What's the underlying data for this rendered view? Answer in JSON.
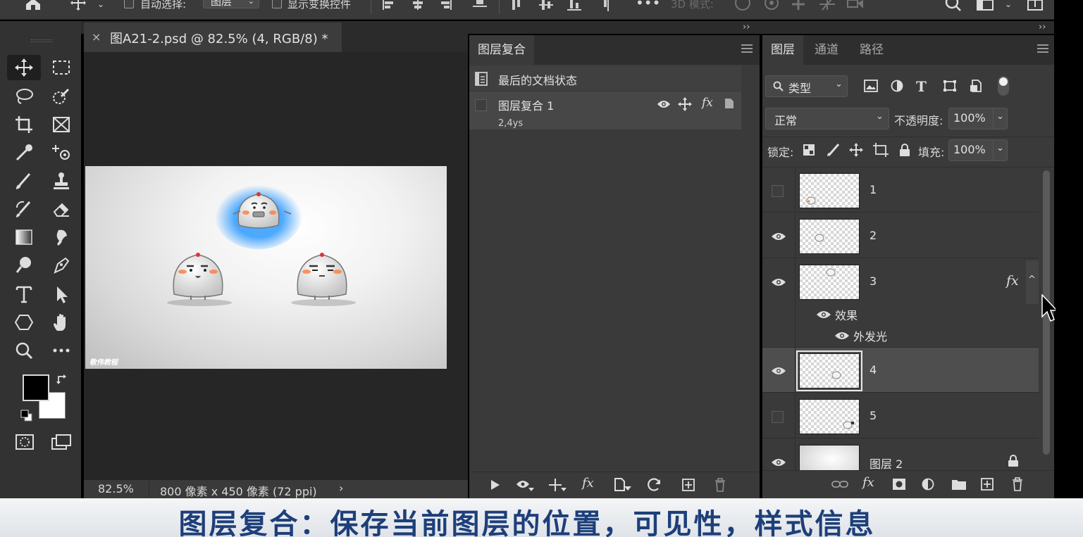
{
  "options_bar": {
    "auto_select_label": "自动选择:",
    "auto_select_target": "图层",
    "show_transform_label": "显示变换控件",
    "mode_3d_label": "3D 模式:"
  },
  "document": {
    "tab_title": "图A21-2.psd @ 82.5% (4, RGB/8) *",
    "zoom": "82.5%",
    "doc_info": "800 像素 x 450 像素 (72 ppi)",
    "watermark": "敬伟教程"
  },
  "layer_comps_panel": {
    "tab": "图层复合",
    "last_state": "最后的文档状态",
    "comps": [
      {
        "name": "图层复合 1",
        "note": "2,4ys"
      }
    ]
  },
  "layers_panel": {
    "tabs": [
      "图层",
      "通道",
      "路径"
    ],
    "filter_kind": "类型",
    "blend_mode": "正常",
    "opacity_label": "不透明度:",
    "opacity_value": "100%",
    "lock_label": "锁定:",
    "fill_label": "填充:",
    "fill_value": "100%",
    "layers": [
      {
        "name": "1",
        "visible": false
      },
      {
        "name": "2",
        "visible": true
      },
      {
        "name": "3",
        "visible": true,
        "fx": "fx",
        "effects_label": "效果",
        "effect": "外发光"
      },
      {
        "name": "4",
        "visible": true,
        "selected": true
      },
      {
        "name": "5",
        "visible": false
      },
      {
        "name": "图层 2",
        "visible": true,
        "locked": true
      }
    ]
  },
  "subtitle": "图层复合：保存当前图层的位置，可见性，样式信息",
  "colors": {
    "accent_glow": "#3aa0ff",
    "subtitle_text": "#1d3f7a",
    "foreground": "#000000",
    "background": "#ffffff"
  }
}
